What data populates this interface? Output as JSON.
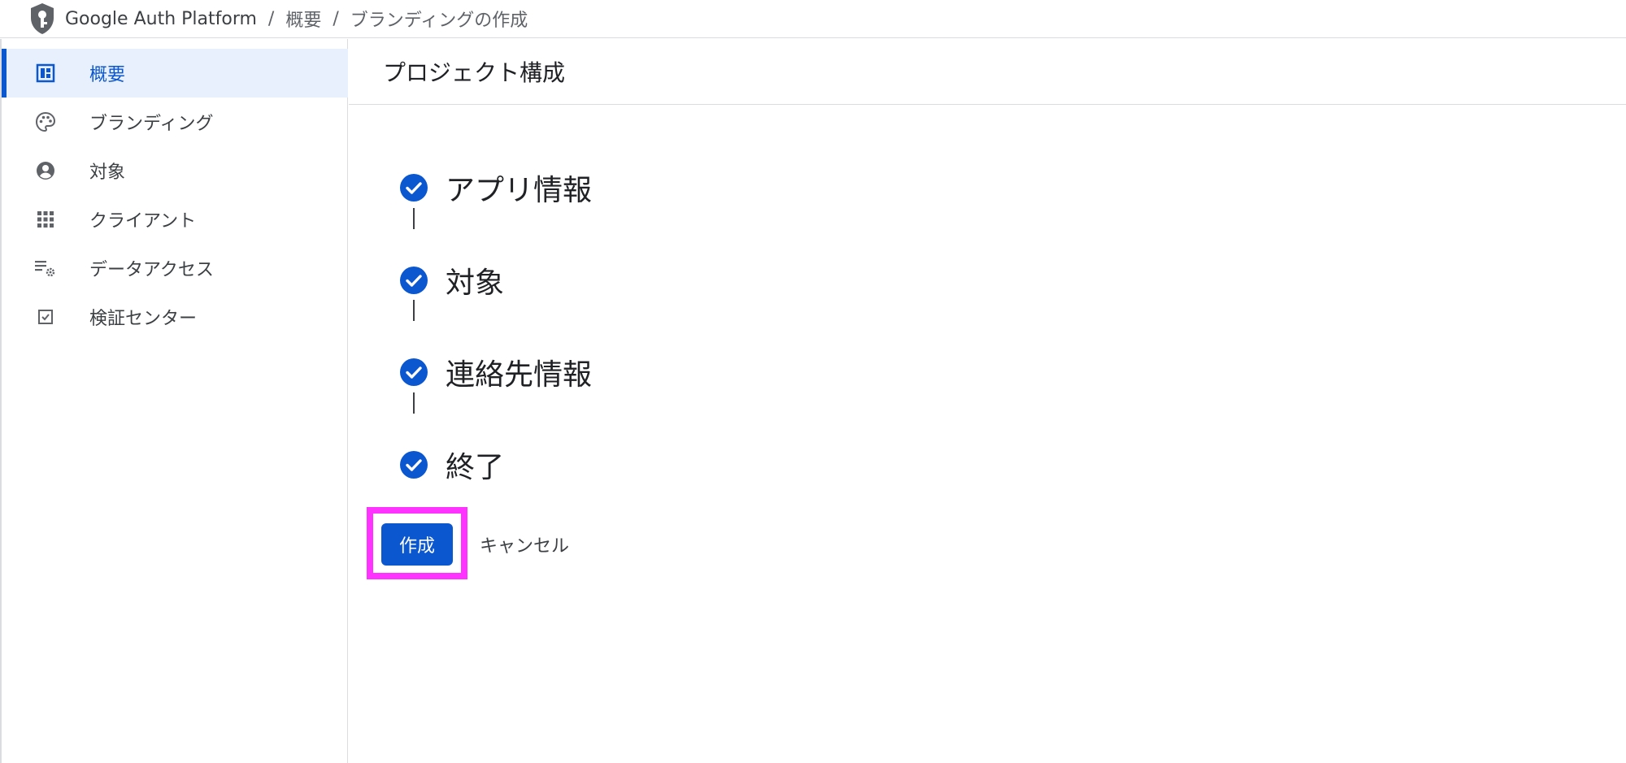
{
  "breadcrumb": {
    "product": "Google Auth Platform",
    "separator": "/",
    "items": [
      "概要",
      "ブランディングの作成"
    ]
  },
  "sidebar": {
    "items": [
      {
        "label": "概要",
        "icon": "dashboard-icon",
        "active": true
      },
      {
        "label": "ブランディング",
        "icon": "palette-icon",
        "active": false
      },
      {
        "label": "対象",
        "icon": "account-circle-icon",
        "active": false
      },
      {
        "label": "クライアント",
        "icon": "apps-grid-icon",
        "active": false
      },
      {
        "label": "データアクセス",
        "icon": "list-settings-icon",
        "active": false
      },
      {
        "label": "検証センター",
        "icon": "checkbox-icon",
        "active": false
      }
    ]
  },
  "main": {
    "title": "プロジェクト構成",
    "steps": [
      {
        "label": "アプリ情報",
        "status": "complete"
      },
      {
        "label": "対象",
        "status": "complete"
      },
      {
        "label": "連絡先情報",
        "status": "complete"
      },
      {
        "label": "終了",
        "status": "complete"
      }
    ],
    "actions": {
      "create_label": "作成",
      "cancel_label": "キャンセル"
    }
  },
  "colors": {
    "accent": "#0b57d0",
    "active_nav_bg": "#e8f0fe",
    "highlight": "#ff33ff",
    "border": "#dadce0"
  }
}
